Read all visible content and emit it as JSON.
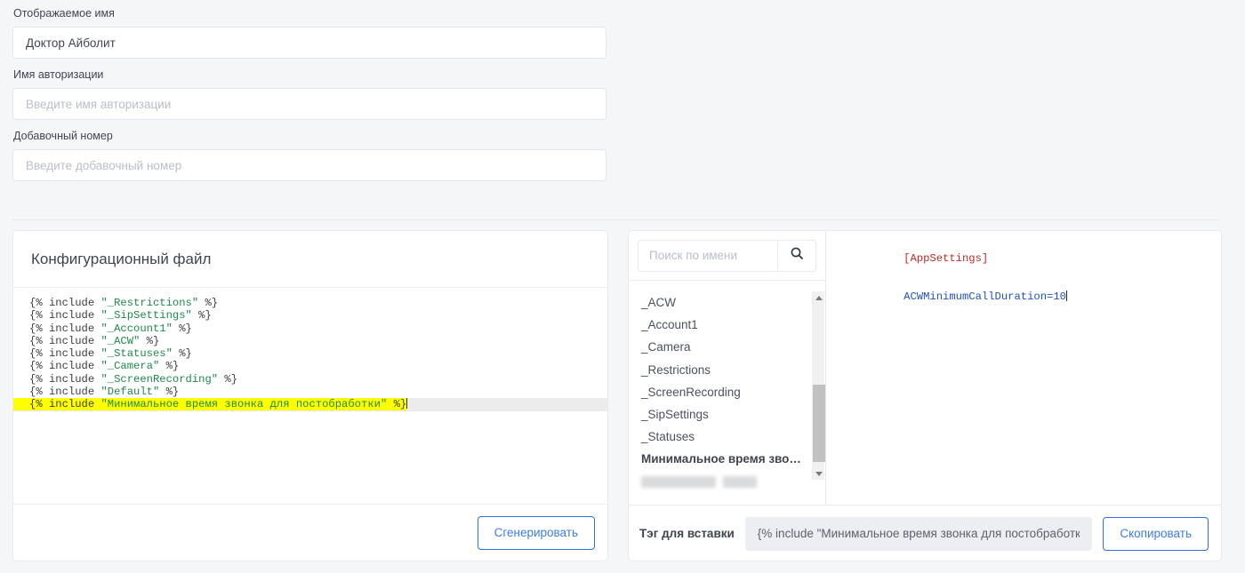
{
  "form": {
    "fields": [
      {
        "label": "Отображаемое имя",
        "value": "Доктор Айболит",
        "placeholder": ""
      },
      {
        "label": "Имя авторизации",
        "value": "",
        "placeholder": "Введите имя авторизации"
      },
      {
        "label": "Добавочный номер",
        "value": "",
        "placeholder": "Введите добавочный номер"
      }
    ]
  },
  "config_panel": {
    "title": "Конфигурационный файл",
    "generate_label": "Сгенерировать",
    "code_lines": [
      {
        "open": "{% include ",
        "string": "\"_Restrictions\"",
        "close": " %}"
      },
      {
        "open": "{% include ",
        "string": "\"_SipSettings\"",
        "close": " %}"
      },
      {
        "open": "{% include ",
        "string": "\"_Account1\"",
        "close": " %}"
      },
      {
        "open": "{% include ",
        "string": "\"_ACW\"",
        "close": " %}"
      },
      {
        "open": "{% include ",
        "string": "\"_Statuses\"",
        "close": " %}"
      },
      {
        "open": "{% include ",
        "string": "\"_Camera\"",
        "close": " %}"
      },
      {
        "open": "{% include ",
        "string": "\"_ScreenRecording\"",
        "close": " %}"
      },
      {
        "open": "{% include ",
        "string": "\"Default\"",
        "close": " %}"
      },
      {
        "open": "{% include ",
        "string": "\"Минимальное время звонка для постобработки\"",
        "close": " %}",
        "active": true
      }
    ]
  },
  "snippet_panel": {
    "search_placeholder": "Поиск по имени",
    "search_value": "",
    "search_icon": "search-icon",
    "items": [
      {
        "label": "_ACW"
      },
      {
        "label": "_Account1"
      },
      {
        "label": "_Camera"
      },
      {
        "label": "_Restrictions"
      },
      {
        "label": "_ScreenRecording"
      },
      {
        "label": "_SipSettings"
      },
      {
        "label": "_Statuses"
      },
      {
        "label": "Минимальное время зво…",
        "selected": true
      },
      {
        "label": "",
        "blurred": true
      }
    ],
    "preview": {
      "section": "[AppSettings]",
      "key_value": "ACWMinimumCallDuration=10"
    },
    "tag_label": "Тэг для вставки",
    "tag_value": "{% include \"Минимальное время звонка для постобработки\" %}",
    "copy_label": "Скопировать"
  },
  "colors": {
    "accent": "#3d7bf0",
    "page_bg": "#f5f6f8",
    "highlight": "#ffff00",
    "string_token": "#1e8a4c",
    "section_token": "#c62828",
    "key_token": "#1f4ec9"
  }
}
